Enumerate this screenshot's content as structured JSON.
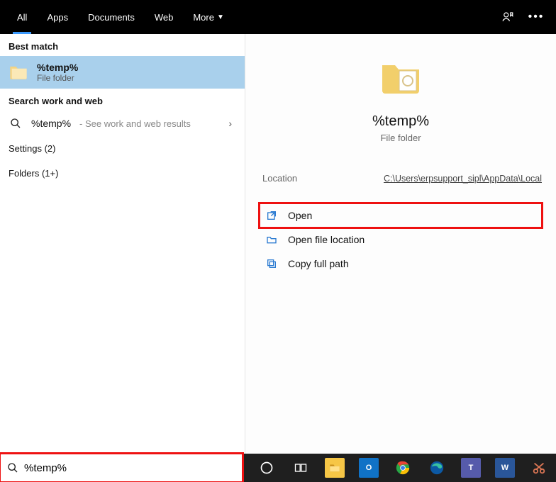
{
  "topbar": {
    "tabs": [
      "All",
      "Apps",
      "Documents",
      "Web",
      "More"
    ],
    "active_index": 0
  },
  "left": {
    "best_match_header": "Best match",
    "best_match": {
      "title": "%temp%",
      "subtitle": "File folder"
    },
    "search_web_header": "Search work and web",
    "web_result": {
      "query": "%temp%",
      "hint": " - See work and web results"
    },
    "settings_row": "Settings (2)",
    "folders_row": "Folders (1+)"
  },
  "preview": {
    "title": "%temp%",
    "subtitle": "File folder",
    "location_label": "Location",
    "location_value": "C:\\Users\\erpsupport_sipl\\AppData\\Local",
    "actions": {
      "open": "Open",
      "open_location": "Open file location",
      "copy_path": "Copy full path"
    }
  },
  "search": {
    "value": "%temp%"
  },
  "taskbar_apps": [
    "cortana",
    "task-view",
    "explorer",
    "outlook",
    "chrome",
    "edge",
    "teams",
    "word",
    "snip"
  ]
}
